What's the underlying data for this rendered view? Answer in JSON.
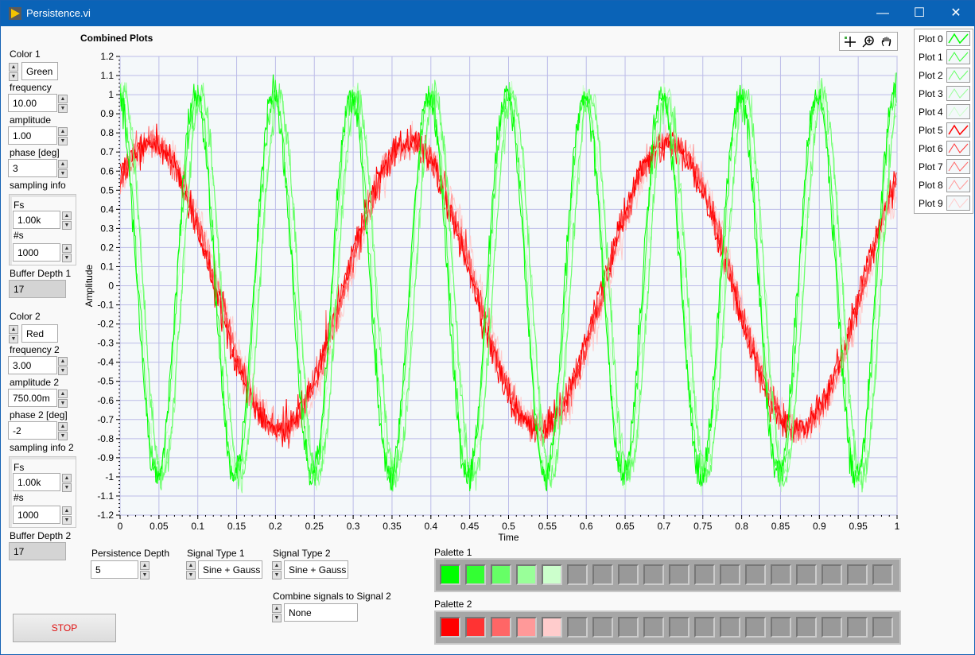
{
  "window": {
    "title": "Persistence.vi",
    "minimize": "—",
    "maximize": "☐",
    "close": "✕"
  },
  "left1": {
    "color_label": "Color 1",
    "color_value": "Green",
    "freq_label": "frequency",
    "freq": "10.00",
    "amp_label": "amplitude",
    "amp": "1.00",
    "phase_label": "phase [deg]",
    "phase": "3",
    "sampling_label": "sampling info",
    "fs_label": "Fs",
    "fs": "1.00k",
    "ns_label": "#s",
    "ns": "1000",
    "buffer_label": "Buffer Depth 1",
    "buffer": "17"
  },
  "left2": {
    "color_label": "Color 2",
    "color_value": "Red",
    "freq_label": "frequency 2",
    "freq": "3.00",
    "amp_label": "amplitude 2",
    "amp": "750.00m",
    "phase_label": "phase 2 [deg]",
    "phase": "-2",
    "sampling_label": "sampling info 2",
    "fs_label": "Fs",
    "fs": "1.00k",
    "ns_label": "#s",
    "ns": "1000",
    "buffer_label": "Buffer Depth 2",
    "buffer": "17"
  },
  "stop_label": "STOP",
  "bottom": {
    "persist_label": "Persistence Depth",
    "persist": "5",
    "sig1_label": "Signal Type 1",
    "sig1": "Sine + Gauss",
    "sig2_label": "Signal Type 2",
    "sig2": "Sine + Gauss",
    "combine_label": "Combine signals to Signal 2",
    "combine": "None",
    "palette1_label": "Palette 1",
    "palette2_label": "Palette 2",
    "palette1": [
      "#00ff00",
      "#33ff33",
      "#66ff66",
      "#99ff99",
      "#ccffcc"
    ],
    "palette2": [
      "#ff0000",
      "#ff3333",
      "#ff6666",
      "#ff9999",
      "#ffcccc"
    ],
    "palette_empty": "#999999",
    "palette_slots": 18
  },
  "toolbar": {
    "icons": [
      "cursor-crosshair-icon",
      "zoom-icon",
      "pan-hand-icon"
    ]
  },
  "chart_data": {
    "type": "line",
    "title": "Combined Plots",
    "xlabel": "Time",
    "ylabel": "Amplitude",
    "xlim": [
      0,
      1
    ],
    "ylim": [
      -1.2,
      1.2
    ],
    "grid": true,
    "legend_placement": "right",
    "xticks": [
      "0",
      "0.05",
      "0.1",
      "0.15",
      "0.2",
      "0.25",
      "0.3",
      "0.35",
      "0.4",
      "0.45",
      "0.5",
      "0.55",
      "0.6",
      "0.65",
      "0.7",
      "0.75",
      "0.8",
      "0.85",
      "0.9",
      "0.95",
      "1"
    ],
    "yticks": [
      "1.2",
      "1.1",
      "1",
      "0.9",
      "0.8",
      "0.7",
      "0.6",
      "0.5",
      "0.4",
      "0.3",
      "0.2",
      "0.1",
      "0",
      "-0.1",
      "-0.2",
      "-0.3",
      "-0.4",
      "-0.5",
      "-0.6",
      "-0.7",
      "-0.8",
      "-0.9",
      "-1",
      "-1.1",
      "-1.2"
    ],
    "signal1": {
      "frequency": 10,
      "amplitude": 1.0,
      "noise_std": 0.04
    },
    "signal2": {
      "frequency": 3,
      "amplitude": 0.75,
      "noise_std": 0.04
    },
    "series": [
      {
        "name": "Plot 0",
        "color": "#00ff00"
      },
      {
        "name": "Plot 1",
        "color": "#33ff33"
      },
      {
        "name": "Plot 2",
        "color": "#66ff66"
      },
      {
        "name": "Plot 3",
        "color": "#99ff99"
      },
      {
        "name": "Plot 4",
        "color": "#ccffcc"
      },
      {
        "name": "Plot 5",
        "color": "#ff0000"
      },
      {
        "name": "Plot 6",
        "color": "#ff3333"
      },
      {
        "name": "Plot 7",
        "color": "#ff6666"
      },
      {
        "name": "Plot 8",
        "color": "#ff9999"
      },
      {
        "name": "Plot 9",
        "color": "#ffcccc"
      }
    ]
  }
}
